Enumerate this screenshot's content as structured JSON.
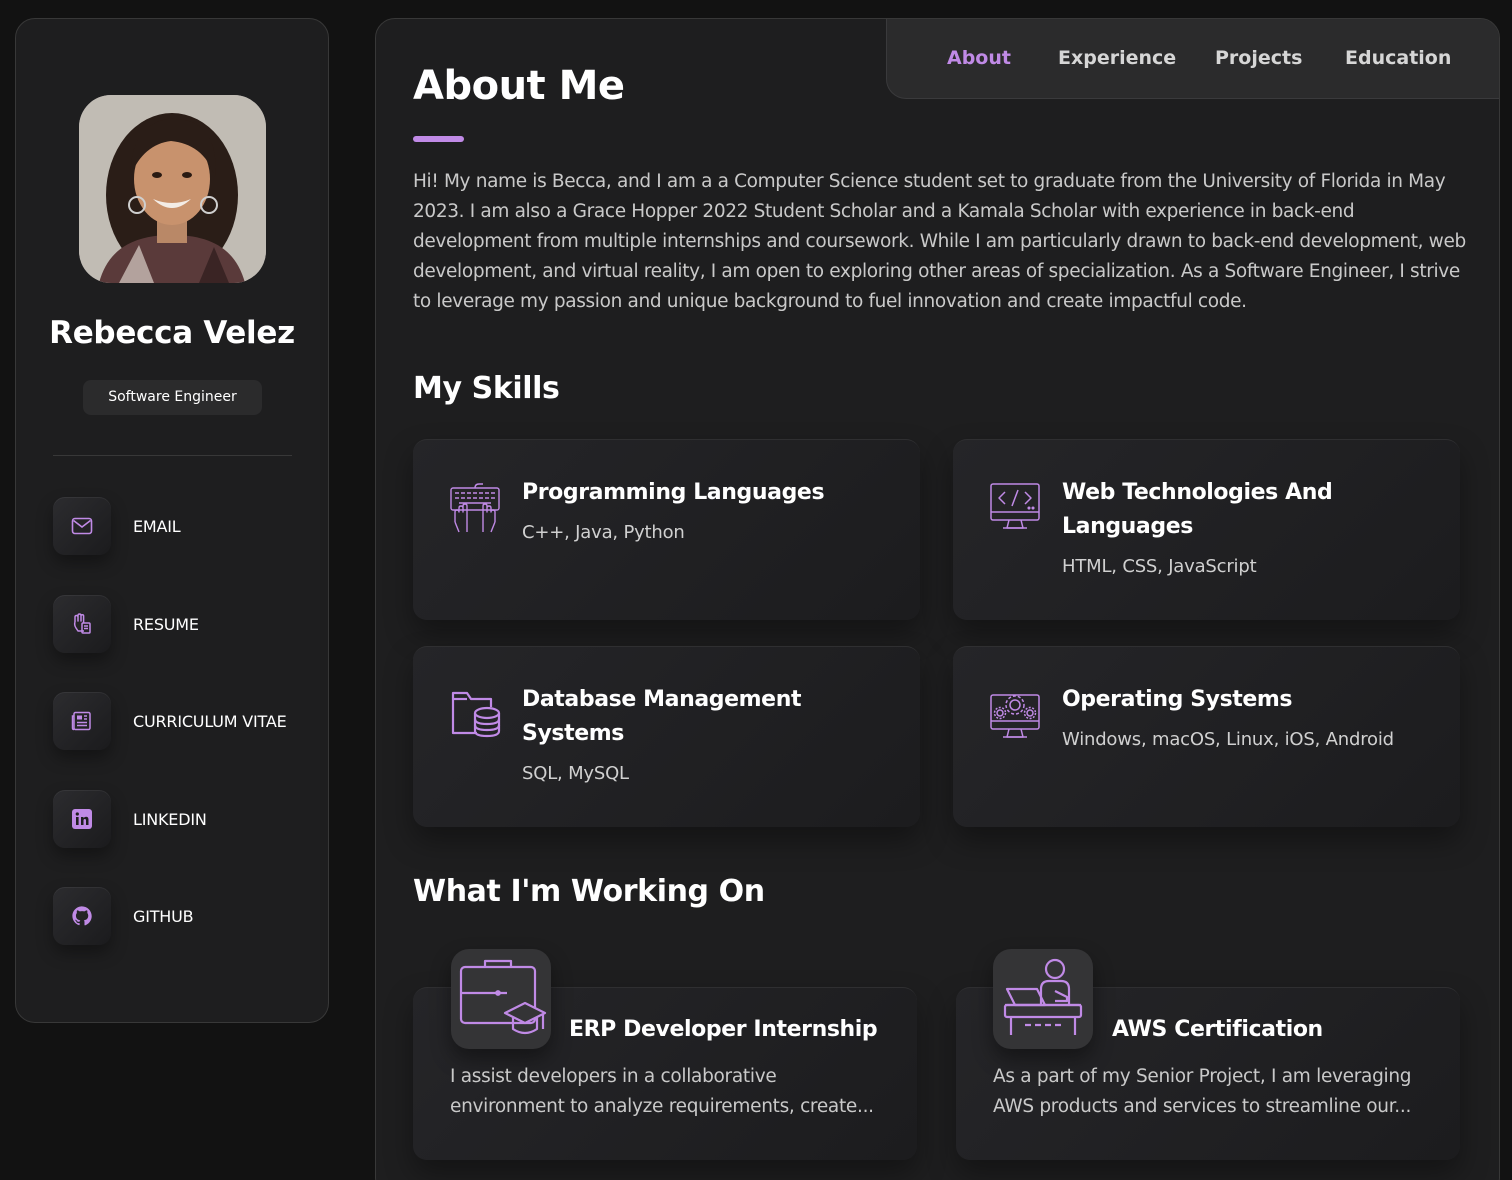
{
  "profile": {
    "name": "Rebecca Velez",
    "role": "Software Engineer",
    "avatar_alt": "Profile photo"
  },
  "contacts": [
    {
      "label": "EMAIL",
      "icon": "mail-icon"
    },
    {
      "label": "RESUME",
      "icon": "hand-document-icon"
    },
    {
      "label": "CURRICULUM VITAE",
      "icon": "newspaper-icon"
    },
    {
      "label": "LINKEDIN",
      "icon": "linkedin-icon"
    },
    {
      "label": "GITHUB",
      "icon": "github-icon"
    }
  ],
  "nav": {
    "items": [
      "About",
      "Experience",
      "Projects",
      "Education"
    ],
    "active": "About"
  },
  "about": {
    "heading": "About Me",
    "text": "Hi! My name is Becca, and I am a a Computer Science student set to graduate from the University of Florida in May 2023. I am also a Grace Hopper 2022 Student Scholar and a Kamala Scholar with experience in back-end development from multiple internships and coursework. While I am particularly drawn to back-end development, web development, and virtual reality, I am open to exploring other areas of specialization. As a Software Engineer, I strive to leverage my passion and unique background to fuel innovation and create impactful code."
  },
  "skills": {
    "heading": "My Skills",
    "items": [
      {
        "title": "Programming Languages",
        "desc": "C++, Java, Python",
        "icon": "keyboard-hands-icon"
      },
      {
        "title": "Web Technologies And Languages",
        "desc": "HTML, CSS, JavaScript",
        "icon": "code-monitor-icon"
      },
      {
        "title": "Database Management Systems",
        "desc": "SQL, MySQL",
        "icon": "folder-database-icon"
      },
      {
        "title": "Operating Systems",
        "desc": "Windows, macOS, Linux, iOS, Android",
        "icon": "monitor-gear-icon"
      }
    ]
  },
  "working": {
    "heading": "What I'm Working On",
    "items": [
      {
        "title": "ERP Developer Internship",
        "desc": "I assist developers in a collaborative environment to analyze requirements, create...",
        "icon": "briefcase-graduation-icon"
      },
      {
        "title": "AWS Certification",
        "desc": "As a part of my Senior Project, I am leveraging AWS products and services to streamline our...",
        "icon": "person-laptop-icon"
      }
    ]
  },
  "colors": {
    "accent": "#c08ae6",
    "background": "#121212",
    "card": "#1e1e1f"
  }
}
